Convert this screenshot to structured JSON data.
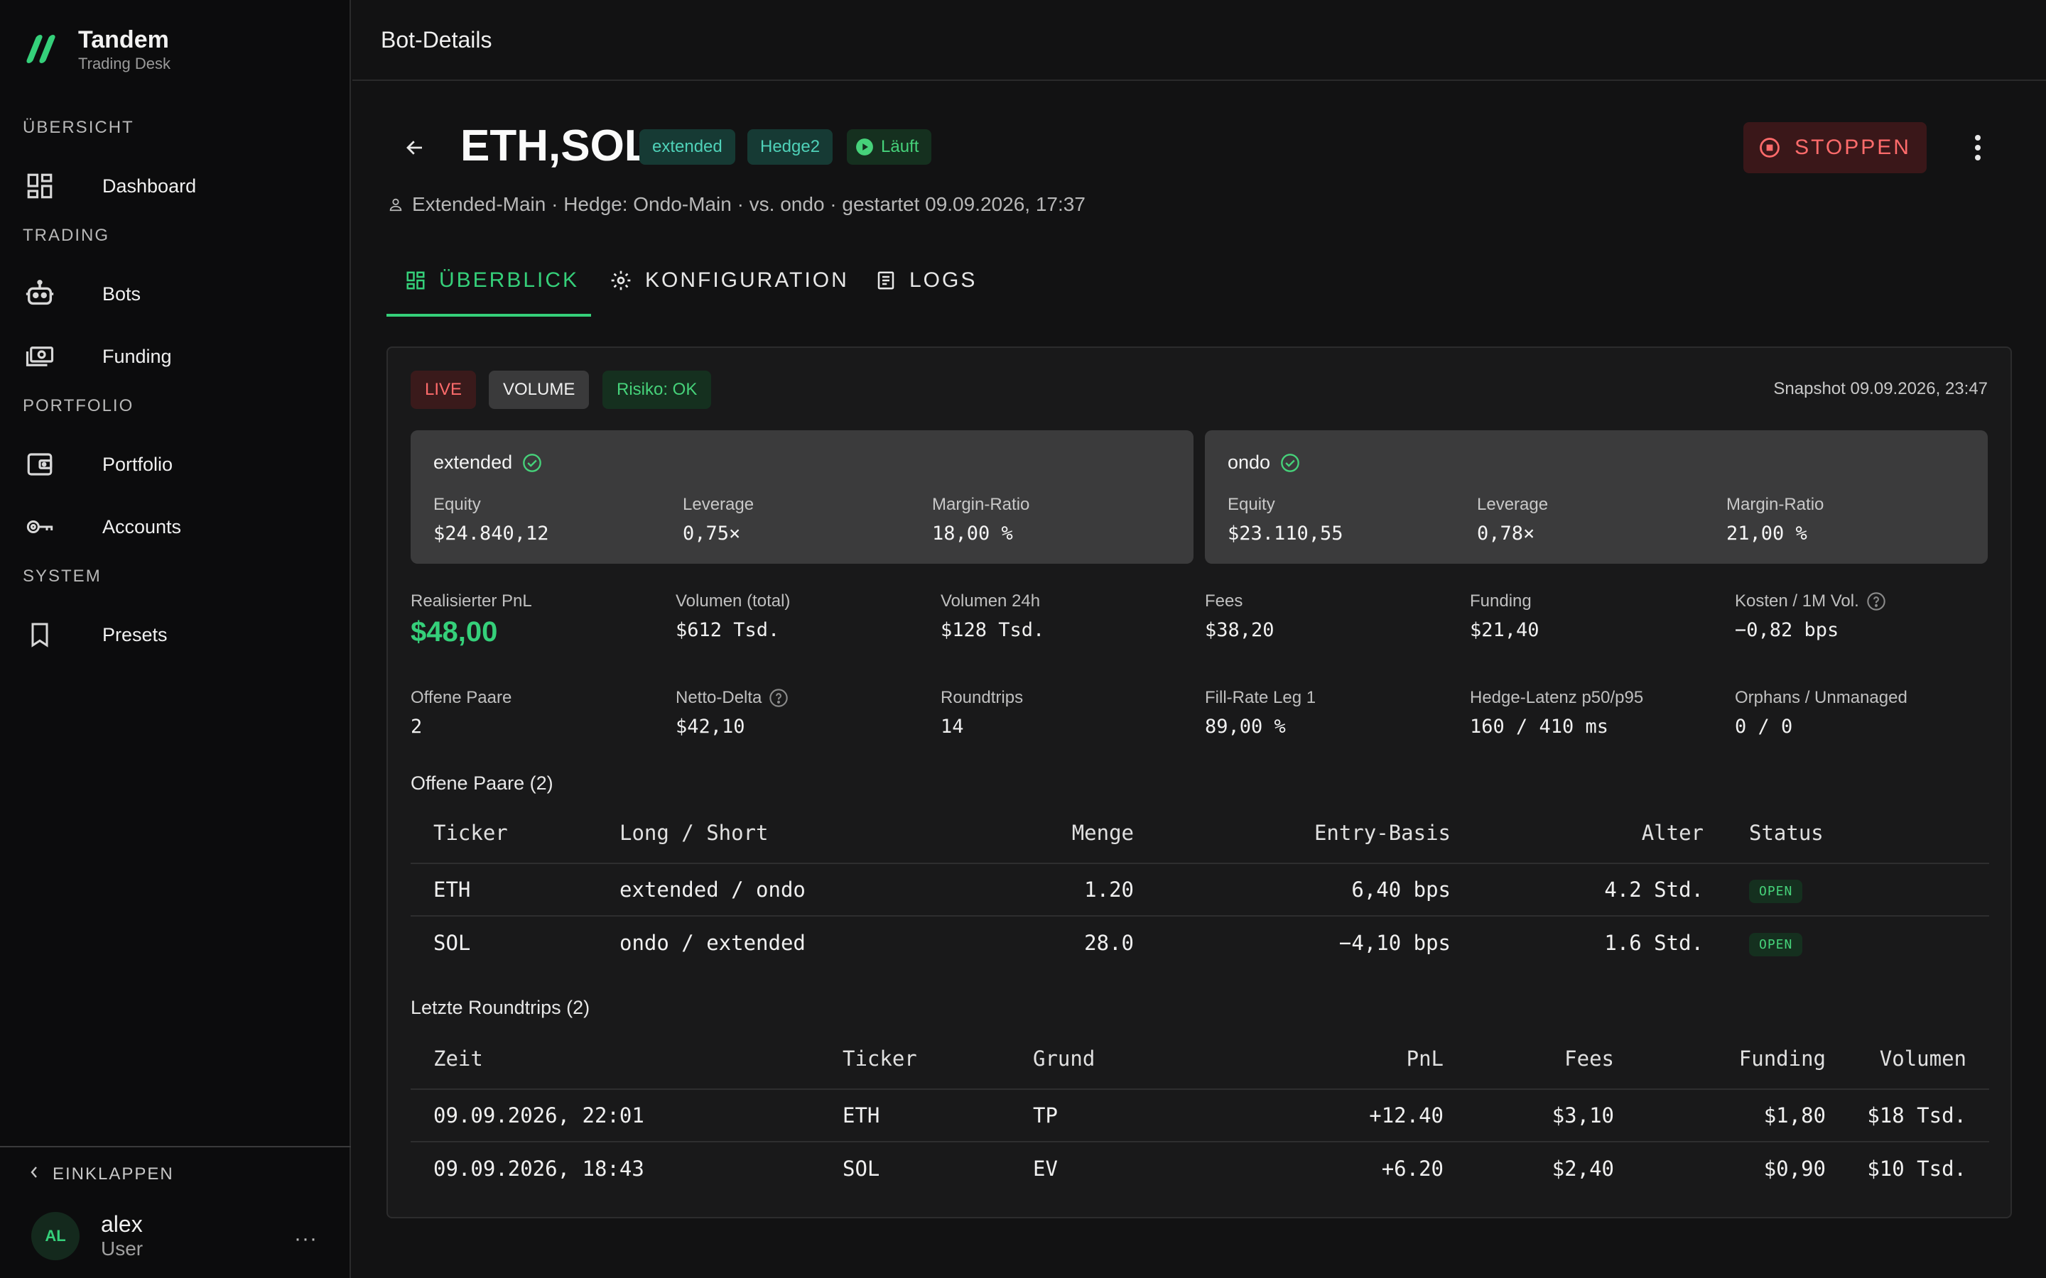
{
  "brand": {
    "title": "Tandem",
    "subtitle": "Trading Desk"
  },
  "nav": {
    "sections": [
      "ÜBERSICHT",
      "TRADING",
      "PORTFOLIO",
      "SYSTEM"
    ],
    "items": [
      {
        "label": "Dashboard",
        "icon": "dashboard-icon"
      },
      {
        "label": "Bots",
        "icon": "robot-icon"
      },
      {
        "label": "Funding",
        "icon": "money-icon"
      },
      {
        "label": "Portfolio",
        "icon": "wallet-icon"
      },
      {
        "label": "Accounts",
        "icon": "key-icon"
      },
      {
        "label": "Presets",
        "icon": "bookmark-icon"
      }
    ],
    "collapse_label": "EINKLAPPEN"
  },
  "user": {
    "initials": "AL",
    "name": "alex",
    "role": "User",
    "more": "···"
  },
  "topbar": {
    "title": "Bot-Details"
  },
  "bot": {
    "title": "ETH,SOL",
    "chips": [
      "extended",
      "Hedge2",
      "Läuft"
    ],
    "subline": "Extended-Main · Hedge: Ondo-Main · vs. ondo · gestartet 09.09.2026, 17:37",
    "stop_label": "STOPPEN"
  },
  "tabs": [
    {
      "label": "ÜBERBLICK",
      "active": true
    },
    {
      "label": "KONFIGURATION",
      "active": false
    },
    {
      "label": "LOGS",
      "active": false
    }
  ],
  "badges": {
    "live": "LIVE",
    "volume": "VOLUME",
    "risk": "Risiko: OK"
  },
  "snapshot": "Snapshot 09.09.2026, 23:47",
  "venues": [
    {
      "name": "extended",
      "equity_label": "Equity",
      "equity": "$24.840,12",
      "leverage_label": "Leverage",
      "leverage": "0,75×",
      "margin_label": "Margin-Ratio",
      "margin": "18,00 %"
    },
    {
      "name": "ondo",
      "equity_label": "Equity",
      "equity": "$23.110,55",
      "leverage_label": "Leverage",
      "leverage": "0,78×",
      "margin_label": "Margin-Ratio",
      "margin": "21,00 %"
    }
  ],
  "metrics": [
    {
      "label": "Realisierter PnL",
      "value": "$48,00"
    },
    {
      "label": "Volumen (total)",
      "value": "$612 Tsd."
    },
    {
      "label": "Volumen 24h",
      "value": "$128 Tsd."
    },
    {
      "label": "Fees",
      "value": "$38,20"
    },
    {
      "label": "Funding",
      "value": "$21,40"
    },
    {
      "label": "Kosten / 1M Vol.",
      "value": "−0,82 bps"
    },
    {
      "label": "Offene Paare",
      "value": "2"
    },
    {
      "label": "Netto-Delta",
      "value": "$42,10"
    },
    {
      "label": "Roundtrips",
      "value": "14"
    },
    {
      "label": "Fill-Rate Leg 1",
      "value": "89,00 %"
    },
    {
      "label": "Hedge-Latenz p50/p95",
      "value": "160 / 410 ms"
    },
    {
      "label": "Orphans / Unmanaged",
      "value": "0 / 0"
    }
  ],
  "open_pairs": {
    "title": "Offene Paare (2)",
    "headers": [
      "Ticker",
      "Long / Short",
      "Menge",
      "Entry-Basis",
      "Alter",
      "Status"
    ],
    "rows": [
      [
        "ETH",
        "extended / ondo",
        "1.20",
        "6,40 bps",
        "4.2 Std.",
        "OPEN"
      ],
      [
        "SOL",
        "ondo / extended",
        "28.0",
        "−4,10 bps",
        "1.6 Std.",
        "OPEN"
      ]
    ]
  },
  "roundtrips": {
    "title": "Letzte Roundtrips (2)",
    "headers": [
      "Zeit",
      "Ticker",
      "Grund",
      "PnL",
      "Fees",
      "Funding",
      "Volumen"
    ],
    "rows": [
      [
        "09.09.2026, 22:01",
        "ETH",
        "TP",
        "+12.40",
        "$3,10",
        "$1,80",
        "$18 Tsd."
      ],
      [
        "09.09.2026, 18:43",
        "SOL",
        "EV",
        "+6.20",
        "$2,40",
        "$0,90",
        "$10 Tsd."
      ]
    ]
  },
  "colors": {
    "accent": "#35d07a",
    "danger": "#ff6b6b",
    "teal": "#4fd1b8"
  }
}
